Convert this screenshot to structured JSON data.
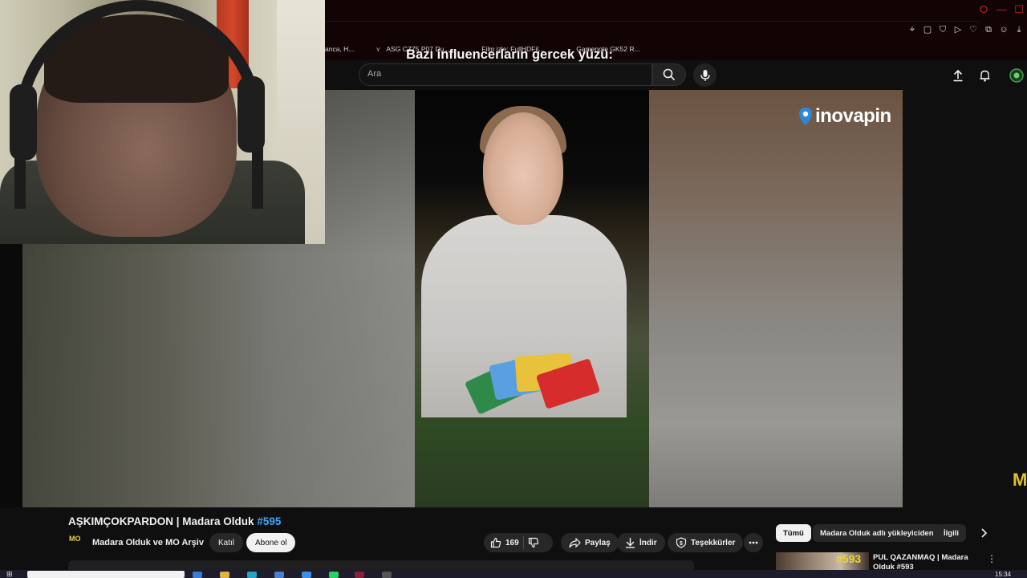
{
  "browser": {
    "window_controls": [
      "⭘",
      "—",
      "☐"
    ],
    "bookmarks": [
      {
        "label": "anca, H...",
        "icon": "folder-icon"
      },
      {
        "label": "ASG CZ75 P07 Du...",
        "icon": "page-icon"
      },
      {
        "label": "Film izle: FullHDFil...",
        "icon": "page-icon"
      },
      {
        "label": "Gamenote GK52 R...",
        "icon": "page-icon"
      }
    ]
  },
  "header": {
    "search_placeholder": "Ara"
  },
  "video": {
    "caption": "Bazı influencerların gercek yüzü:",
    "brand_logo": "inovapin",
    "edge_letter": "M",
    "colors": {
      "brand_pin": "#2e86d6",
      "accent_yellow": "#e3c02a"
    }
  },
  "watch": {
    "title_main": "AŞKIMÇOKPARDON | Madara Olduk ",
    "title_hashtag": "#595",
    "channel_avatar_text": "MO",
    "channel_name": "Madara Olduk ve MO Arşiv",
    "join_label": "Katıl",
    "subscribe_label": "Abone ol",
    "like_count": "169",
    "share_label": "Paylaş",
    "download_label": "İndir",
    "thanks_label": "Teşekkürler",
    "desc_preview": ""
  },
  "sidebar": {
    "chips": [
      "Tümü",
      "Madara Olduk adlı yükleyiciden",
      "İlgili"
    ],
    "recommendation": {
      "thumb_label": "#593",
      "title": "PUL QAZANMAQ | Madara Olduk #593"
    }
  },
  "taskbar": {
    "clock": "15:34"
  }
}
